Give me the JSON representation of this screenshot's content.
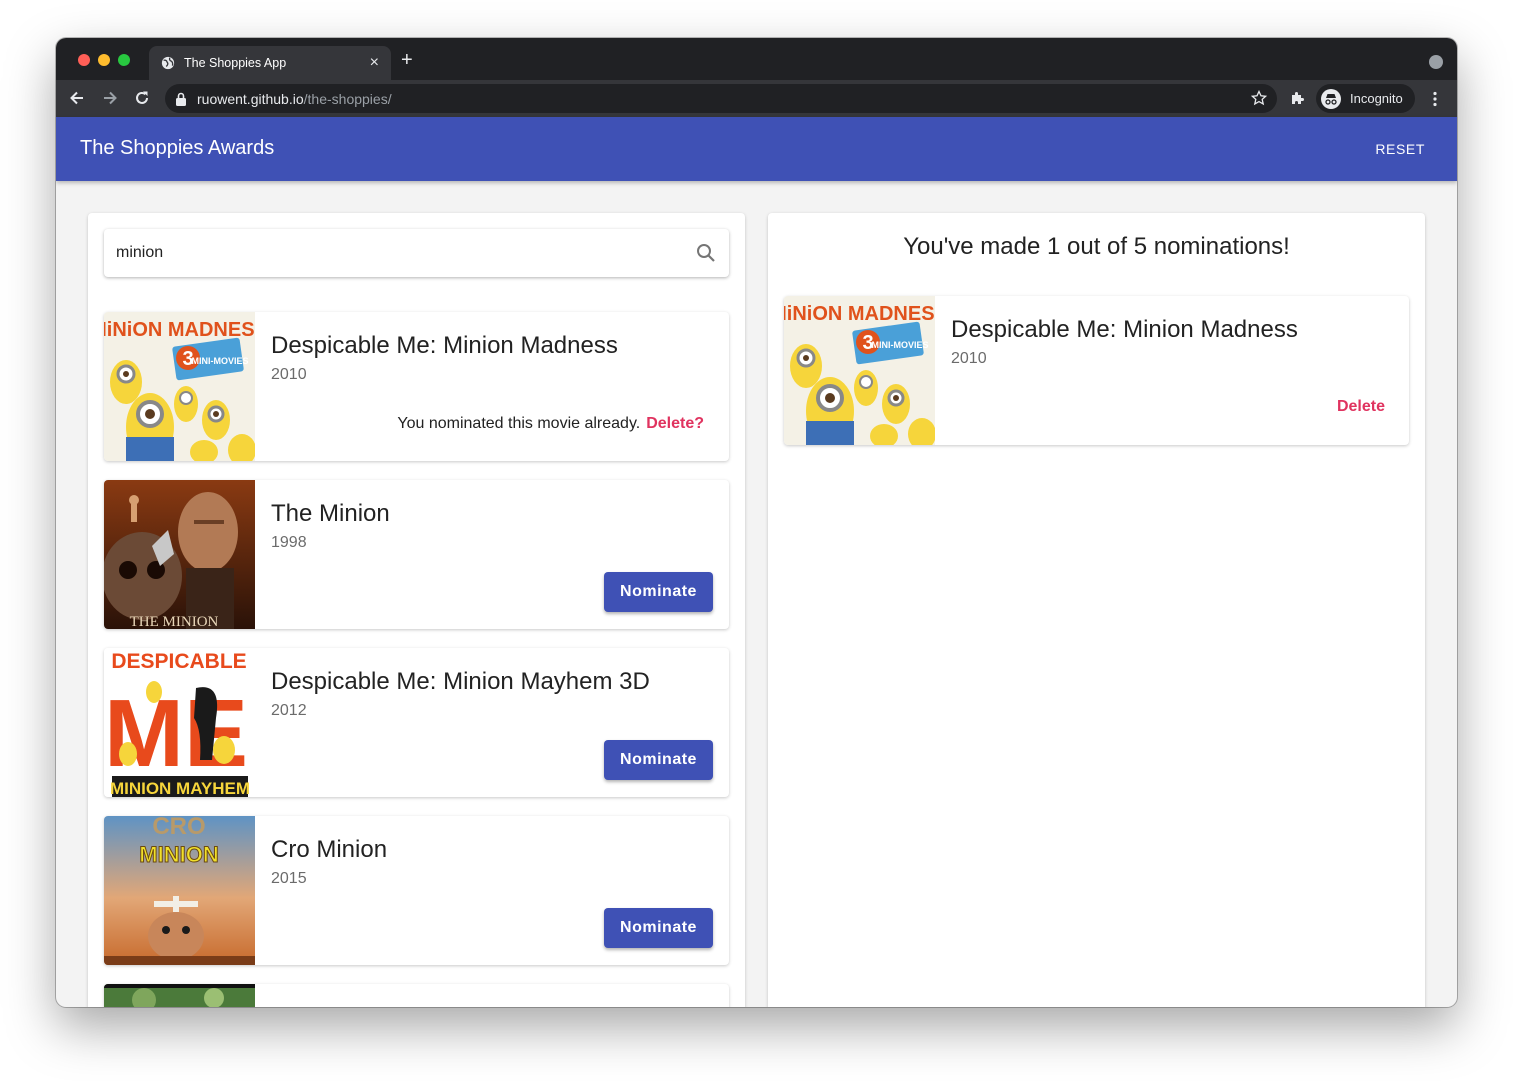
{
  "browser": {
    "tab_title": "The Shoppies App",
    "tab_close": "×",
    "new_tab": "+",
    "url_host": "ruowent.github.io",
    "url_path": "/the-shoppies/",
    "profile_label": "Incognito",
    "icons": [
      "globe-icon",
      "back-icon",
      "forward-icon",
      "reload-icon",
      "lock-icon",
      "star-icon",
      "extensions-icon",
      "incognito-icon",
      "kebab-menu-icon",
      "tab-search-icon"
    ],
    "traffic_lights": {
      "close": "#ff5f57",
      "minimize": "#febc2e",
      "maximize": "#28c840"
    }
  },
  "app": {
    "title": "The Shoppies Awards",
    "reset_label": "RESET",
    "accent": "#3f51b5",
    "danger": "#e0335f"
  },
  "search": {
    "value": "minion",
    "icon": "search-icon"
  },
  "results": [
    {
      "title": "Despicable Me: Minion Madness",
      "year": "2010",
      "nominated": true,
      "note": "You nominated this movie already.",
      "delete_label": "Delete?"
    },
    {
      "title": "The Minion",
      "year": "1998",
      "nominated": false,
      "button_label": "Nominate"
    },
    {
      "title": "Despicable Me: Minion Mayhem 3D",
      "year": "2012",
      "nominated": false,
      "button_label": "Nominate"
    },
    {
      "title": "Cro Minion",
      "year": "2015",
      "nominated": false,
      "button_label": "Nominate"
    }
  ],
  "nominations": {
    "heading": "You've made 1 out of 5 nominations!",
    "items": [
      {
        "title": "Despicable Me: Minion Madness",
        "year": "2010",
        "delete_label": "Delete"
      }
    ]
  },
  "posters": {
    "minion_madness": {
      "title": "MiNiON MADNESS",
      "badge_number": "3",
      "badge_text": "MINI-MOVIES"
    },
    "minion_mayhem": {
      "top": "DESPICABLE",
      "big": "ME",
      "bottom": "MINION MAYHEM"
    },
    "the_minion": {
      "caption": "THE MINION"
    },
    "cro_minion": {
      "top": "CRO",
      "bottom": "MINION"
    }
  }
}
